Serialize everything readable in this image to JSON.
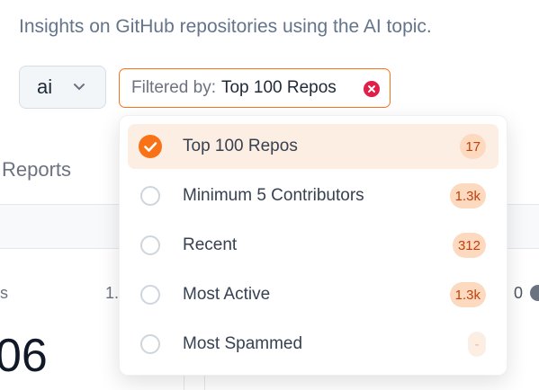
{
  "header": {
    "subtitle": "Insights on GitHub repositories using the AI topic."
  },
  "topic_select": {
    "value": "ai",
    "icon": "chevron-down-icon"
  },
  "filter": {
    "prefix": "Filtered by:",
    "value": "Top 100 Repos",
    "clear_icon": "close-circle-icon"
  },
  "background": {
    "tab_label": "Reports",
    "left_fragment": "s",
    "left_value": "1.",
    "big_value": "06",
    "right_value": "0",
    "help_icon": "help-circle-icon"
  },
  "dropdown": {
    "options": [
      {
        "label": "Top 100 Repos",
        "count": "17",
        "selected": true
      },
      {
        "label": "Minimum 5 Contributors",
        "count": "1.3k",
        "selected": false
      },
      {
        "label": "Recent",
        "count": "312",
        "selected": false
      },
      {
        "label": "Most Active",
        "count": "1.3k",
        "selected": false
      },
      {
        "label": "Most Spammed",
        "count": "-",
        "selected": false
      }
    ]
  },
  "colors": {
    "accent": "#f97316",
    "selected_bg": "#fdeee4",
    "badge_bg": "#fcd9bf",
    "badge_text": "#c2410c",
    "clear_icon": "#e11d48"
  }
}
